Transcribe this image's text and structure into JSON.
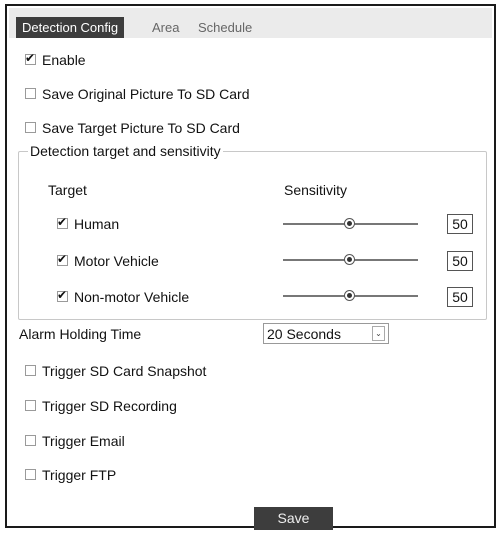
{
  "tabs": [
    {
      "label": "Detection Config",
      "active": true
    },
    {
      "label": "Area",
      "active": false
    },
    {
      "label": "Schedule",
      "active": false
    }
  ],
  "options_top": [
    {
      "label": "Enable",
      "checked": true
    },
    {
      "label": "Save Original Picture To SD Card",
      "checked": false
    },
    {
      "label": "Save Target Picture To SD Card",
      "checked": false
    }
  ],
  "detection": {
    "legend": "Detection target and sensitivity",
    "target_header": "Target",
    "sensitivity_header": "Sensitivity",
    "targets": [
      {
        "label": "Human",
        "checked": true,
        "sensitivity": "50"
      },
      {
        "label": "Motor Vehicle",
        "checked": true,
        "sensitivity": "50"
      },
      {
        "label": "Non-motor Vehicle",
        "checked": true,
        "sensitivity": "50"
      }
    ]
  },
  "alarm": {
    "label": "Alarm Holding Time",
    "value": "20 Seconds"
  },
  "triggers": [
    {
      "label": "Trigger SD Card Snapshot",
      "checked": false
    },
    {
      "label": "Trigger SD Recording",
      "checked": false
    },
    {
      "label": "Trigger Email",
      "checked": false
    },
    {
      "label": "Trigger FTP",
      "checked": false
    }
  ],
  "save_label": "Save",
  "check_glyph": "✔"
}
